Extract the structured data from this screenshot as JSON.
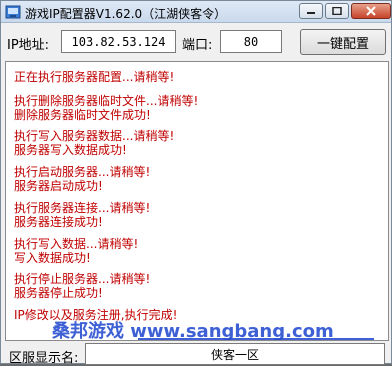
{
  "window": {
    "title": "游戏IP配置器V1.62.0（江湖侠客令）"
  },
  "form": {
    "ip_label": "IP地址:",
    "ip_value": "103.82.53.124",
    "port_label": "端口:",
    "port_value": "80",
    "one_click_button": "一键配置"
  },
  "log": {
    "groups": [
      [
        "正在执行服务器配置...请稍等!"
      ],
      [
        "执行删除服务器临时文件...请稍等!",
        "删除服务器临时文件成功!"
      ],
      [
        "执行写入服务器数据...请稍等!",
        "服务器写入数据成功!"
      ],
      [
        "执行启动服务器...请稍等!",
        "服务器启动成功!"
      ],
      [
        "执行服务器连接...请稍等!",
        "服务器连接成功!"
      ],
      [
        "执行写入数据...请稍等!",
        "写入数据成功!"
      ],
      [
        "执行停止服务器...请稍等!",
        "服务器停止成功!"
      ],
      [
        "IP修改以及服务注册,执行完成!"
      ]
    ],
    "watermark": "桑邦游戏 www.sangbang.com"
  },
  "footer": {
    "server_name_label": "区服显示名:",
    "server_name_value": "侠客一区"
  },
  "colors": {
    "log_text": "#c00000",
    "watermark": "#2a4fd1"
  }
}
